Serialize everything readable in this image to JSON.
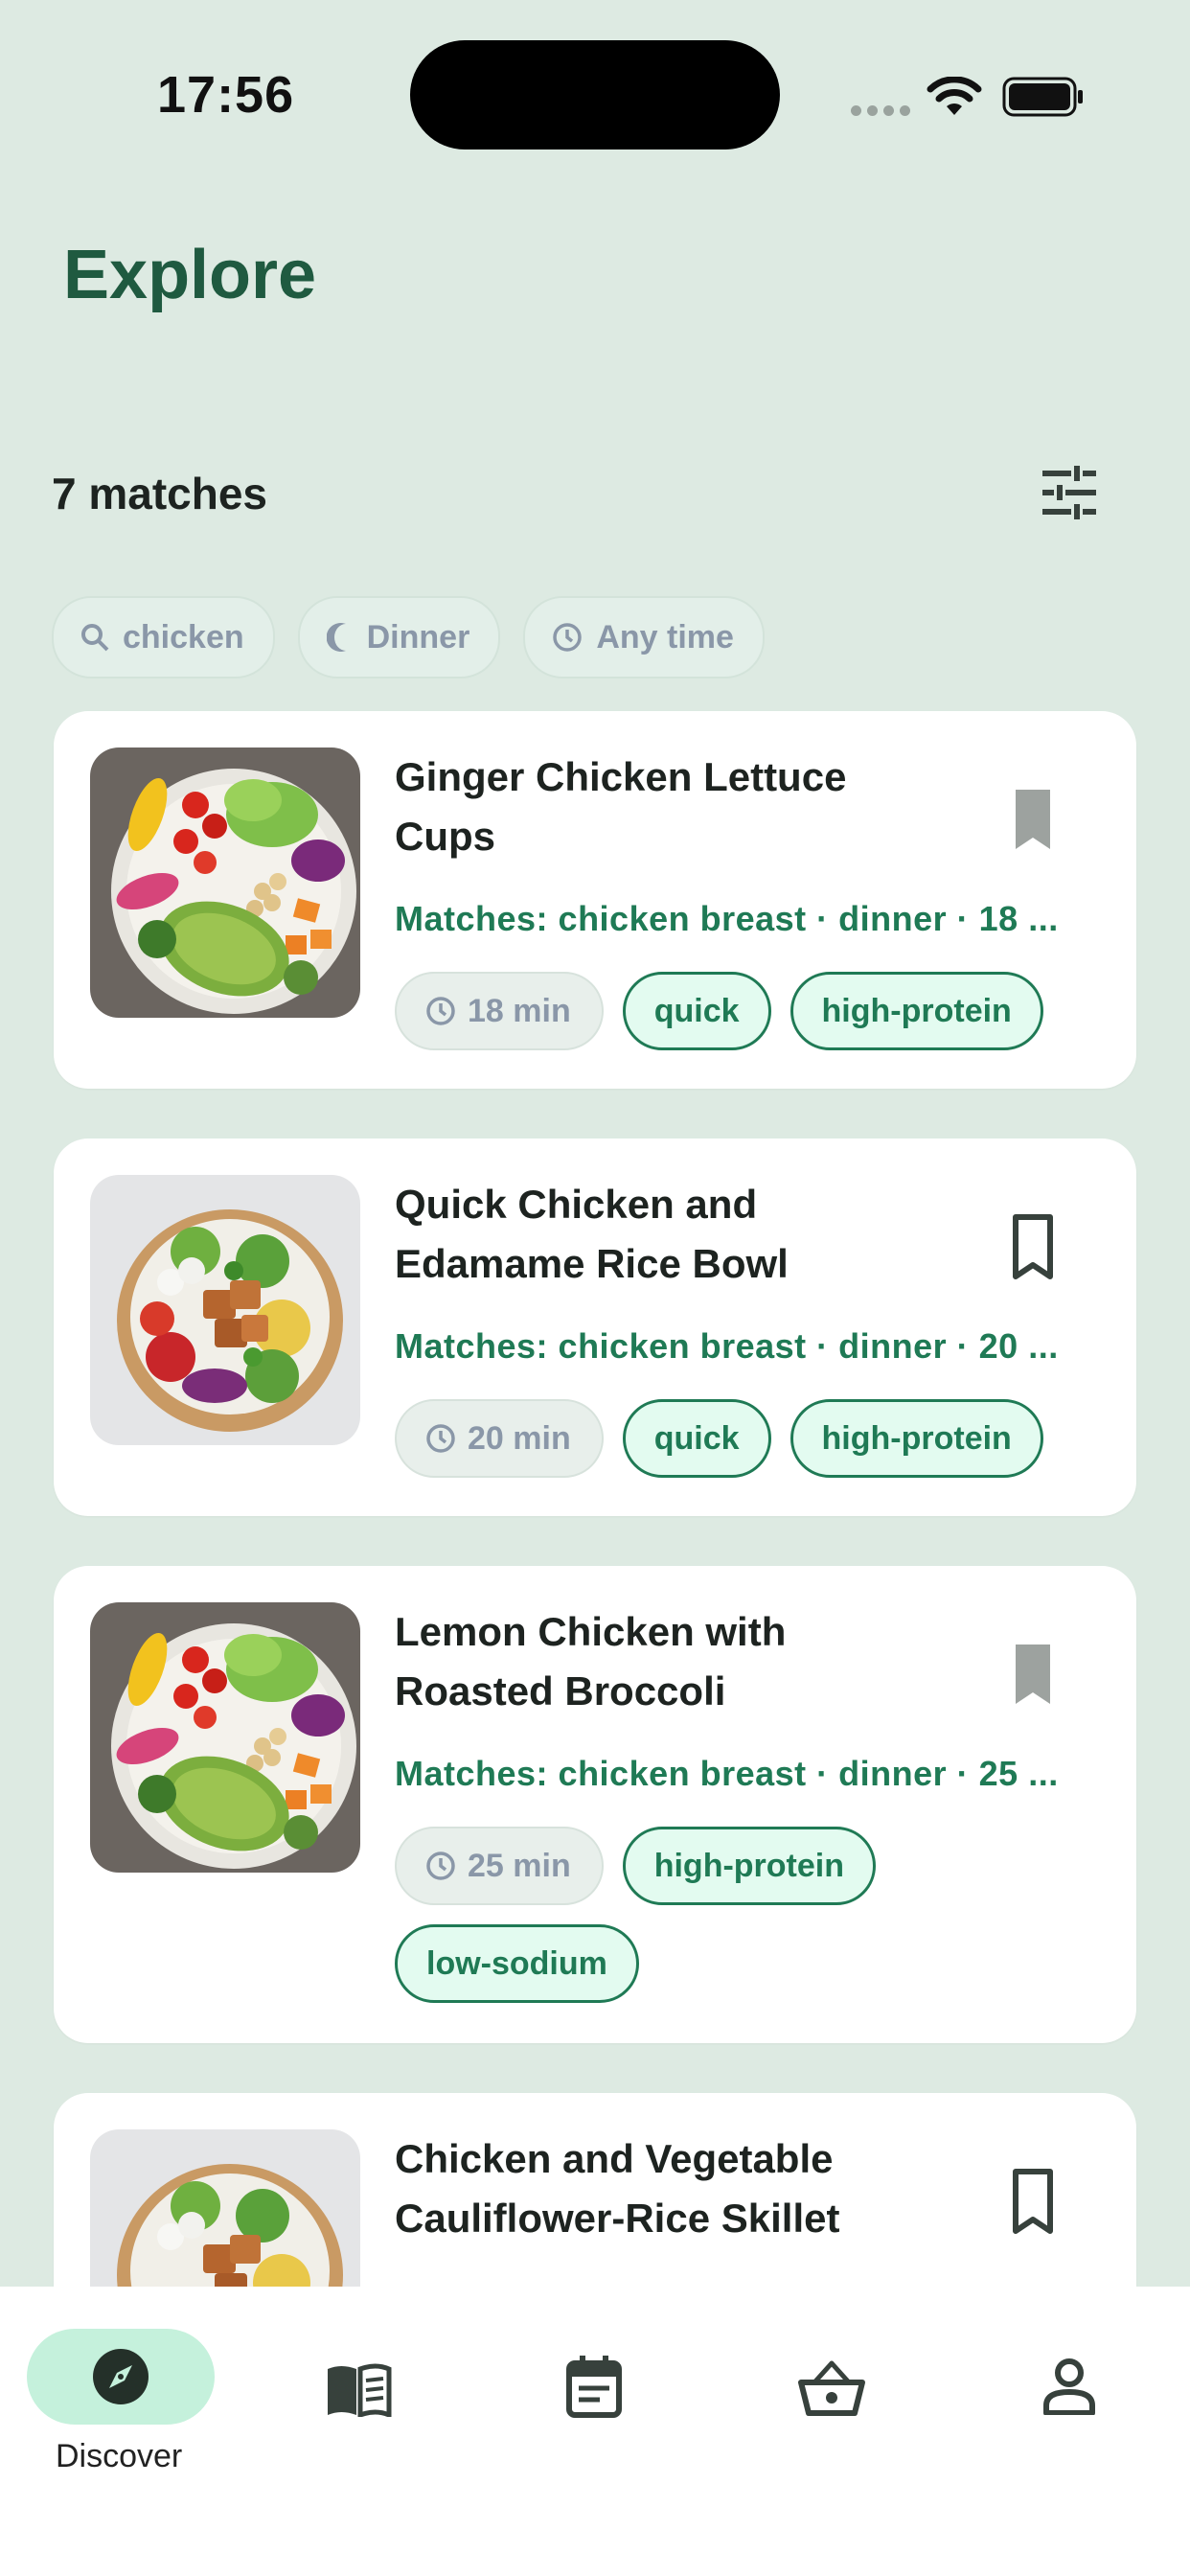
{
  "status": {
    "time": "17:56"
  },
  "header": {
    "title": "Explore"
  },
  "results": {
    "count_label": "7 matches"
  },
  "filters": [
    {
      "icon": "search-icon",
      "label": "chicken"
    },
    {
      "icon": "moon-icon",
      "label": "Dinner"
    },
    {
      "icon": "clock-icon",
      "label": "Any time"
    }
  ],
  "recipes": [
    {
      "title": "Ginger Chicken Lettuce Cups",
      "match": "Matches: chicken breast · dinner · 18 ...",
      "time": "18 min",
      "tags": [
        "quick",
        "high-protein"
      ],
      "saved": true
    },
    {
      "title": "Quick Chicken and Edamame Rice Bowl",
      "match": "Matches: chicken breast · dinner · 20 ...",
      "time": "20 min",
      "tags": [
        "quick",
        "high-protein"
      ],
      "saved": false
    },
    {
      "title": "Lemon Chicken with Roasted Broccoli",
      "match": "Matches: chicken breast · dinner · 25 ...",
      "time": "25 min",
      "tags": [
        "high-protein",
        "low-sodium"
      ],
      "saved": true
    },
    {
      "title": "Chicken and Vegetable Cauliflower-Rice Skillet",
      "saved": false
    }
  ],
  "nav": {
    "active_label": "Discover",
    "items": [
      "compass-icon",
      "book-icon",
      "calendar-icon",
      "basket-icon",
      "person-icon"
    ]
  },
  "colors": {
    "accent": "#1f7a55",
    "title": "#1f5a40",
    "background": "#ddeae2",
    "pill": "#c5f1dc"
  }
}
